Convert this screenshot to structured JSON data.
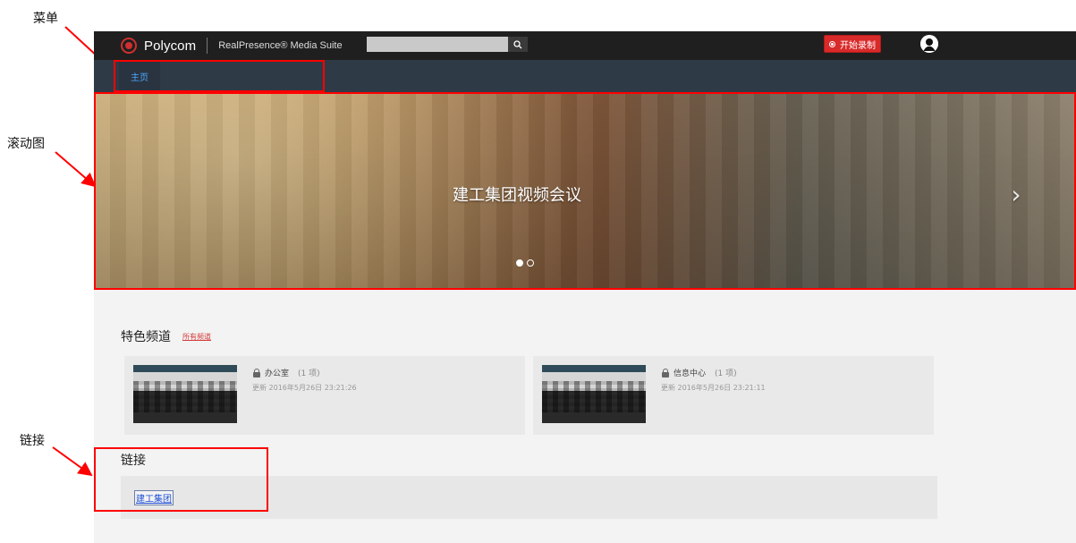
{
  "annotations": {
    "menu_label": "菜单",
    "carousel_label": "滚动图",
    "links_label": "链接"
  },
  "app": {
    "brand": "Polycom",
    "product": "RealPresence® Media Suite",
    "search": {
      "placeholder": ""
    },
    "record_button_label": "开始录制",
    "nav": {
      "home_label": "主页"
    },
    "carousel": {
      "title": "建工集团视频会议",
      "dots": {
        "count": 2,
        "active_index": 0
      }
    },
    "featured_channels": {
      "title": "特色频道",
      "more_link": "所有频道",
      "items": [
        {
          "name": "办公室",
          "count_text": "(1 项)",
          "updated": "更新 2016年5月26日 23:21:26"
        },
        {
          "name": "信息中心",
          "count_text": "(1 项)",
          "updated": "更新 2016年5月26日 23:21:11"
        }
      ]
    },
    "links": {
      "title": "链接",
      "items": [
        {
          "label": "建工集团"
        }
      ]
    }
  },
  "colors": {
    "annotation_red": "#ff0000",
    "topbar_bg": "#1f1f1f",
    "navbar_bg": "#2f3a47",
    "record_red": "#d92a2a",
    "link_blue": "#1f4fd6"
  },
  "icons": {
    "search": "search-icon",
    "record": "record-icon",
    "avatar": "user-avatar-icon",
    "lock": "lock-icon",
    "next": "chevron-right-icon"
  }
}
